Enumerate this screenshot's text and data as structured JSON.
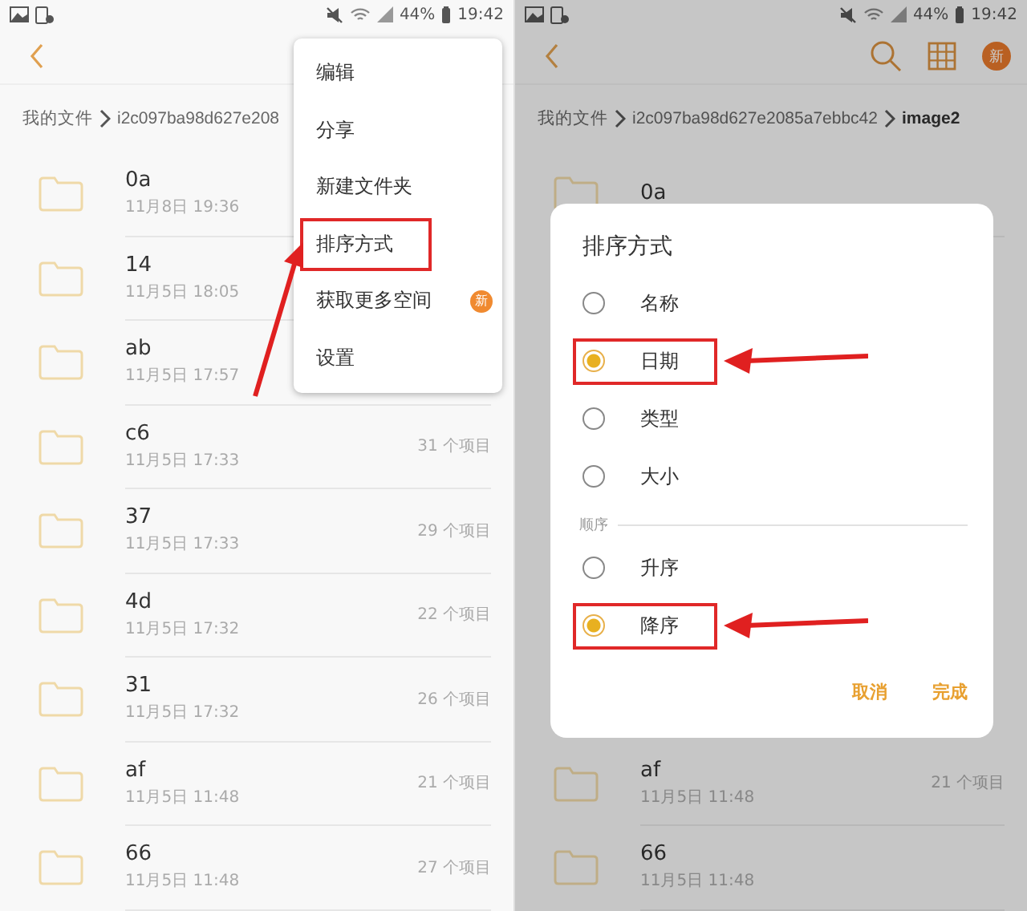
{
  "left_screen": {
    "status_bar": {
      "battery": "44%",
      "time": "19:42"
    },
    "breadcrumb": [
      {
        "label": "我的文件",
        "current": false
      },
      {
        "label": "i2c097ba98d627e208",
        "current": false
      }
    ],
    "folders": [
      {
        "name": "0a",
        "date": "11月8日 19:36"
      },
      {
        "name": "14",
        "date": "11月5日 18:05"
      },
      {
        "name": "ab",
        "date": "11月5日 17:57"
      },
      {
        "name": "c6",
        "date": "11月5日 17:33",
        "count": "31 个项目"
      },
      {
        "name": "37",
        "date": "11月5日 17:33",
        "count": "29 个项目"
      },
      {
        "name": "4d",
        "date": "11月5日 17:32",
        "count": "22 个项目"
      },
      {
        "name": "31",
        "date": "11月5日 17:32",
        "count": "26 个项目"
      },
      {
        "name": "af",
        "date": "11月5日 11:48",
        "count": "21 个项目"
      },
      {
        "name": "66",
        "date": "11月5日 11:48",
        "count": "27 个项目"
      }
    ],
    "menu": {
      "items": [
        {
          "label": "编辑",
          "highlighted": false
        },
        {
          "label": "分享",
          "highlighted": false
        },
        {
          "label": "新建文件夹",
          "highlighted": false
        },
        {
          "label": "排序方式",
          "highlighted": true
        },
        {
          "label": "获取更多空间",
          "highlighted": false,
          "badge": "新"
        },
        {
          "label": "设置",
          "highlighted": false
        }
      ]
    }
  },
  "right_screen": {
    "status_bar": {
      "battery": "44%",
      "time": "19:42"
    },
    "toolbar_badge": "新",
    "breadcrumb": [
      {
        "label": "我的文件",
        "current": false
      },
      {
        "label": "i2c097ba98d627e2085a7ebbc42",
        "current": false
      },
      {
        "label": "image2",
        "current": true
      }
    ],
    "folders_above": [
      {
        "name": "0a"
      }
    ],
    "folders_below": [
      {
        "name": "af",
        "date": "11月5日 11:48",
        "count": "21 个项目"
      },
      {
        "name": "66",
        "date": "11月5日 11:48"
      }
    ],
    "dialog": {
      "title": "排序方式",
      "sort_options": [
        {
          "label": "名称",
          "selected": false,
          "highlighted": false
        },
        {
          "label": "日期",
          "selected": true,
          "highlighted": true
        },
        {
          "label": "类型",
          "selected": false,
          "highlighted": false
        },
        {
          "label": "大小",
          "selected": false,
          "highlighted": false
        }
      ],
      "order_heading": "顺序",
      "order_options": [
        {
          "label": "升序",
          "selected": false,
          "highlighted": false
        },
        {
          "label": "降序",
          "selected": true,
          "highlighted": true
        }
      ],
      "buttons": [
        "取消",
        "完成"
      ]
    }
  }
}
